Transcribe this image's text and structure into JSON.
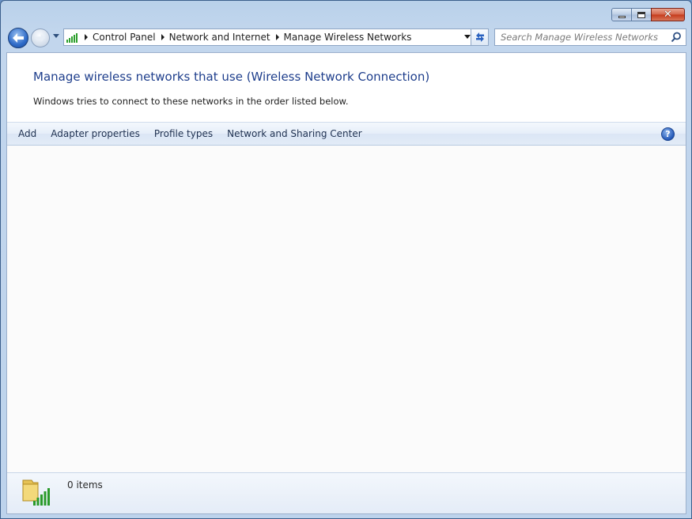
{
  "window": {
    "controls": {
      "minimize": "minimize-icon",
      "maximize": "maximize-icon",
      "close": "close-icon"
    }
  },
  "navigation": {
    "back_icon": "back-arrow-icon",
    "forward_icon": "forward-arrow-icon",
    "breadcrumb": [
      "Control Panel",
      "Network and Internet",
      "Manage Wireless Networks"
    ],
    "refresh_icon": "refresh-icon"
  },
  "search": {
    "placeholder": "Search Manage Wireless Networks",
    "value": ""
  },
  "main": {
    "heading": "Manage wireless networks that use (Wireless Network Connection)",
    "subtext": "Windows tries to connect to these networks in the order listed below."
  },
  "toolbar": {
    "items": [
      "Add",
      "Adapter properties",
      "Profile types",
      "Network and Sharing Center"
    ],
    "help_label": "?"
  },
  "networks": [],
  "details": {
    "count_label": "0 items"
  },
  "colors": {
    "heading": "#1e3e8c",
    "frame": "#b9d1ea",
    "accent": "#2f6bc8"
  }
}
